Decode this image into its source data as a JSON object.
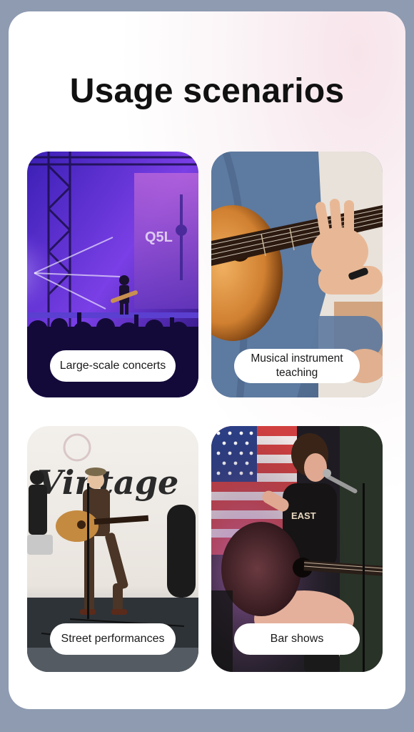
{
  "page": {
    "title": "Usage scenarios"
  },
  "scenarios": [
    {
      "label": "Large-scale concerts",
      "image": "concert-stage-photo",
      "overlay_text": "Q5L"
    },
    {
      "label": "Musical instrument\nteaching",
      "image": "guitar-teaching-photo"
    },
    {
      "label": "Street performances",
      "image": "street-performance-photo",
      "overlay_text": "Vintage"
    },
    {
      "label": "Bar shows",
      "image": "bar-show-photo",
      "overlay_text": "EAST"
    }
  ],
  "colors": {
    "outer_background": "#8e9bb1",
    "card_background": "#ffffff",
    "title": "#111111",
    "pill_background": "#ffffff"
  }
}
